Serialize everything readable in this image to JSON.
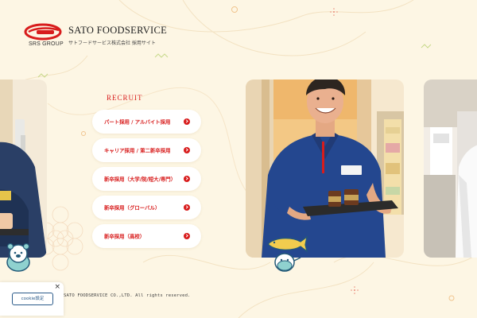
{
  "header": {
    "logo_group": "SRS GROUP",
    "company_name": "SATO FOODSERVICE",
    "company_subtitle": "サトフードサービス株式会社 採用サイト"
  },
  "recruit": {
    "title": "RECRUIT",
    "items": [
      {
        "label": "パート採用 / アルバイト採用"
      },
      {
        "label": "キャリア採用 / 第二新卒採用"
      },
      {
        "label": "新卒採用（大学/院/短大/専門）"
      },
      {
        "label": "新卒採用（グローバル）"
      },
      {
        "label": "新卒採用（高校）"
      }
    ]
  },
  "footer": {
    "copyright": "SATO FOODSERVICE CO.,LTD. All rights reserved."
  },
  "cookie": {
    "button_label": "cookie設定",
    "close_label": "×"
  },
  "colors": {
    "background": "#fdf6e4",
    "brand_red": "#d81c1c",
    "cookie_border": "#2b5b8a"
  },
  "icons": [
    "brand-logo-icon",
    "arrow-right-icon",
    "close-icon",
    "mascot-character-icon",
    "fish-character-icon"
  ]
}
